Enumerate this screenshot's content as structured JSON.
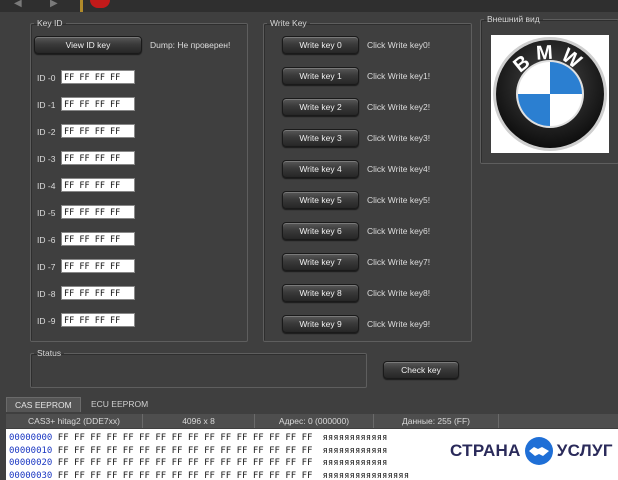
{
  "key_id": {
    "legend": "Key ID",
    "view_button": "View ID key",
    "dump_label": "Dump: Не проверен!",
    "rows": [
      {
        "label": "ID -0",
        "value": "FF FF FF FF"
      },
      {
        "label": "ID -1",
        "value": "FF FF FF FF"
      },
      {
        "label": "ID -2",
        "value": "FF FF FF FF"
      },
      {
        "label": "ID -3",
        "value": "FF FF FF FF"
      },
      {
        "label": "ID -4",
        "value": "FF FF FF FF"
      },
      {
        "label": "ID -5",
        "value": "FF FF FF FF"
      },
      {
        "label": "ID -6",
        "value": "FF FF FF FF"
      },
      {
        "label": "ID -7",
        "value": "FF FF FF FF"
      },
      {
        "label": "ID -8",
        "value": "FF FF FF FF"
      },
      {
        "label": "ID -9",
        "value": "FF FF FF FF"
      }
    ]
  },
  "write_key": {
    "legend": "Write Key",
    "rows": [
      {
        "button": "Write key 0",
        "status": "Click Write key0!"
      },
      {
        "button": "Write key 1",
        "status": "Click Write key1!"
      },
      {
        "button": "Write key 2",
        "status": "Click Write key2!"
      },
      {
        "button": "Write key 3",
        "status": "Click Write key3!"
      },
      {
        "button": "Write key 4",
        "status": "Click Write key4!"
      },
      {
        "button": "Write key 5",
        "status": "Click Write key5!"
      },
      {
        "button": "Write key 6",
        "status": "Click Write key6!"
      },
      {
        "button": "Write key 7",
        "status": "Click Write key7!"
      },
      {
        "button": "Write key 8",
        "status": "Click Write key8!"
      },
      {
        "button": "Write key 9",
        "status": "Click Write key9!"
      }
    ]
  },
  "appearance": {
    "legend": "Внешний вид",
    "logo_text": "BMW",
    "logo_icon": "bmw-logo-icon"
  },
  "status": {
    "legend": "Status"
  },
  "check_key_button": "Check key",
  "tabs": [
    "CAS EEPROM",
    "ECU EEPROM"
  ],
  "active_tab": "CAS EEPROM",
  "hex_header": {
    "chip": "CAS3+ hitag2 (DDE7xx)",
    "size": "4096 x 8",
    "address": "Адрес: 0 (000000)",
    "data": "Данные: 255 (FF)"
  },
  "hex_rows": [
    {
      "addr": "00000000",
      "bytes": "FF FF FF FF FF FF FF FF FF FF FF FF FF FF FF FF",
      "ascii": "яяяяяяяяяяяя"
    },
    {
      "addr": "00000010",
      "bytes": "FF FF FF FF FF FF FF FF FF FF FF FF FF FF FF FF",
      "ascii": "яяяяяяяяяяяя"
    },
    {
      "addr": "00000020",
      "bytes": "FF FF FF FF FF FF FF FF FF FF FF FF FF FF FF FF",
      "ascii": "яяяяяяяяяяяя"
    },
    {
      "addr": "00000030",
      "bytes": "FF FF FF FF FF FF FF FF FF FF FF FF FF FF FF FF",
      "ascii": "яяяяяяяяяяяяяяяя"
    }
  ],
  "watermark": {
    "left": "СТРАНА",
    "right": "УСЛУГ",
    "icon": "handshake-icon"
  },
  "colors": {
    "bmw_blue": "#2b7fd1",
    "watermark_blue": "#1f6fd6",
    "hex_address": "#1a37c2"
  }
}
